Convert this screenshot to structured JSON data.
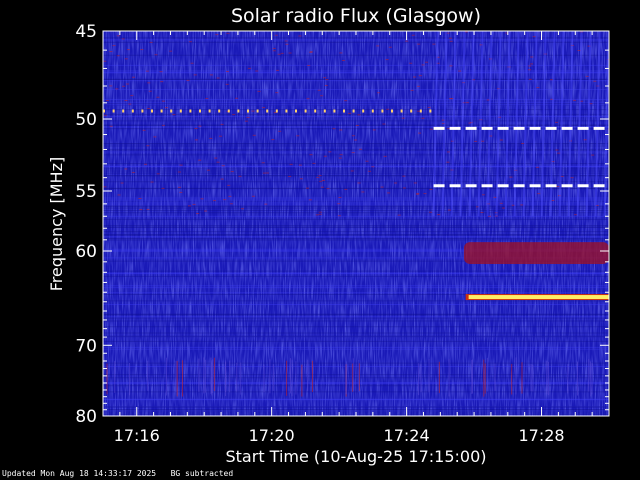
{
  "chart_data": {
    "type": "heatmap",
    "title": "Solar radio Flux (Glasgow)",
    "xlabel": "Start Time (10-Aug-25 17:15:00)",
    "ylabel": "Frequency [MHz]",
    "x_unit": "minutes after 17:15:00",
    "xlim": [
      0,
      15
    ],
    "ylim": [
      45,
      80
    ],
    "y_scale": "reciprocal",
    "x_ticks": [
      {
        "value": 1,
        "label": "17:16"
      },
      {
        "value": 5,
        "label": "17:20"
      },
      {
        "value": 9,
        "label": "17:24"
      },
      {
        "value": 13,
        "label": "17:28"
      }
    ],
    "y_ticks": [
      {
        "value": 45,
        "label": "45"
      },
      {
        "value": 50,
        "label": "50"
      },
      {
        "value": 55,
        "label": "55"
      },
      {
        "value": 60,
        "label": "60"
      },
      {
        "value": 70,
        "label": "70"
      },
      {
        "value": 80,
        "label": "80"
      }
    ],
    "features": [
      {
        "kind": "saturated-line",
        "freq": 64.5,
        "t_start": 10.75,
        "t_end": 15,
        "color": "#ffee66"
      },
      {
        "kind": "dashed-line",
        "freq": 50.6,
        "t_start": 9.8,
        "t_end": 15,
        "color": "#ffffff"
      },
      {
        "kind": "dashed-line",
        "freq": 54.6,
        "t_start": 9.8,
        "t_end": 15,
        "color": "#ffffff"
      },
      {
        "kind": "dotted-line",
        "freq": 49.5,
        "t_start": 0,
        "t_end": 9.8,
        "color": "#ffd070"
      },
      {
        "kind": "emission-band",
        "freq_start": 59.2,
        "freq_end": 61.2,
        "t_start": 10.7,
        "t_end": 15,
        "color": "#a01020"
      }
    ],
    "colors": {
      "background": "#1a1ab8",
      "noise": "#3a3aff",
      "hot": "#cc2020",
      "axes": "#ffffff"
    }
  },
  "footer": {
    "updated": "Updated Mon Aug 18 14:33:17 2025",
    "note": "BG subtracted"
  }
}
